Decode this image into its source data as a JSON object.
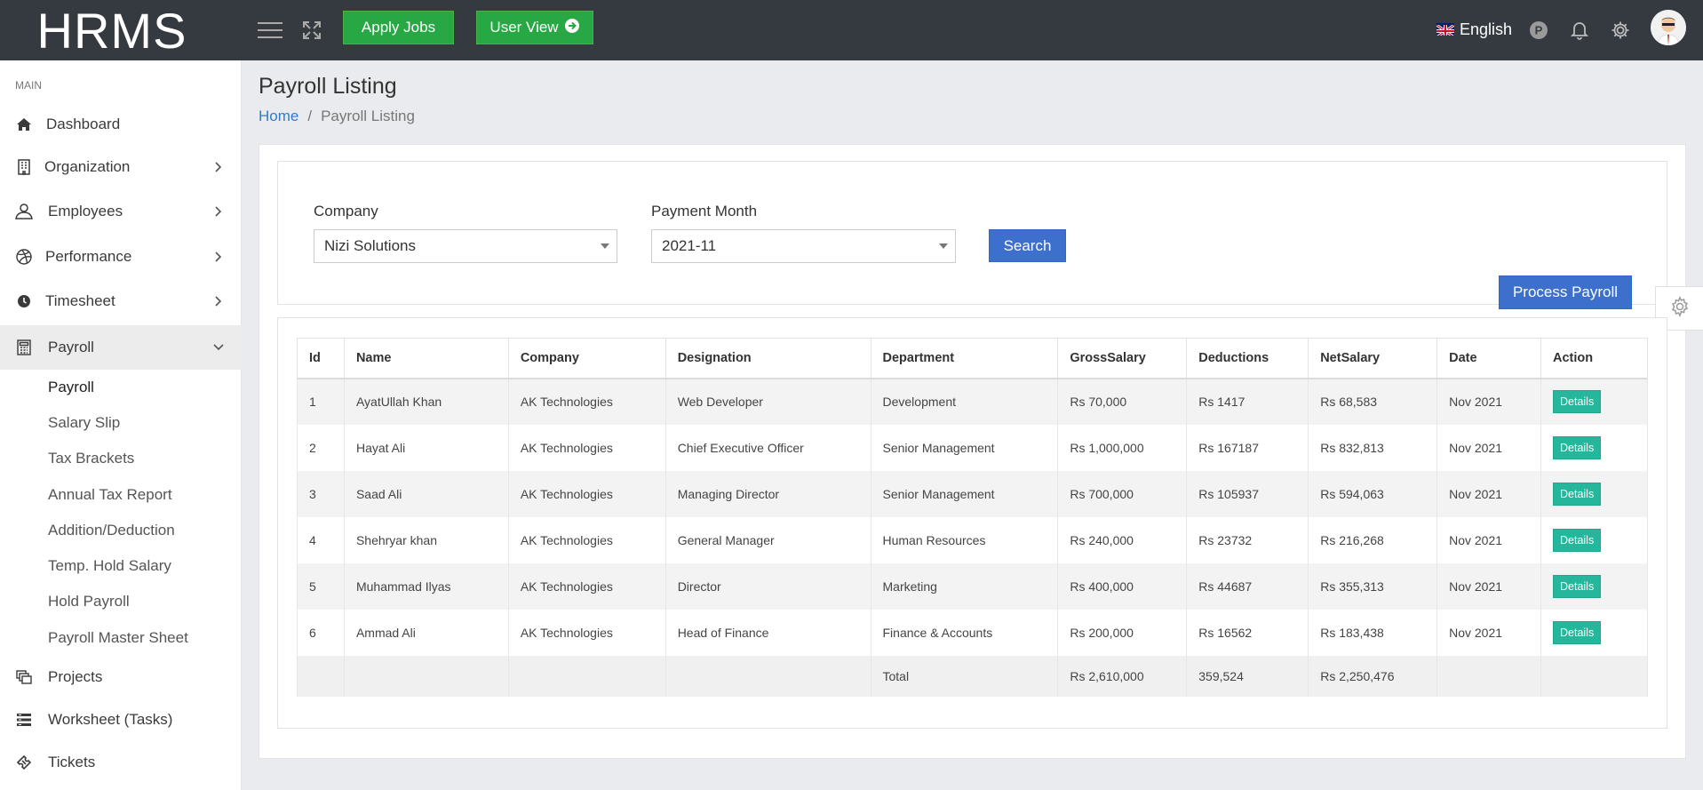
{
  "app": {
    "logo": "HRMS",
    "apply_jobs": "Apply Jobs",
    "user_view": "User View",
    "language": "English"
  },
  "sidebar": {
    "section": "MAIN",
    "items": [
      {
        "label": "Dashboard",
        "icon": "home-icon"
      },
      {
        "label": "Organization",
        "icon": "building-icon"
      },
      {
        "label": "Employees",
        "icon": "user-icon"
      },
      {
        "label": "Performance",
        "icon": "dribbble-icon"
      },
      {
        "label": "Timesheet",
        "icon": "clock-icon"
      },
      {
        "label": "Payroll",
        "icon": "calculator-icon"
      },
      {
        "label": "Projects",
        "icon": "layers-icon"
      },
      {
        "label": "Worksheet (Tasks)",
        "icon": "list-icon"
      },
      {
        "label": "Tickets",
        "icon": "ticket-icon"
      }
    ],
    "payroll_sub": [
      "Payroll",
      "Salary Slip",
      "Tax Brackets",
      "Annual Tax Report",
      "Addition/Deduction",
      "Temp. Hold Salary",
      "Hold Payroll",
      "Payroll Master Sheet"
    ]
  },
  "page": {
    "title": "Payroll Listing",
    "breadcrumb_home": "Home",
    "breadcrumb_sep": "/",
    "breadcrumb_current": "Payroll Listing"
  },
  "filters": {
    "company_label": "Company",
    "company_value": "Nizi Solutions",
    "month_label": "Payment Month",
    "month_value": "2021-11",
    "search": "Search",
    "process": "Process Payroll"
  },
  "table": {
    "headers": [
      "Id",
      "Name",
      "Company",
      "Designation",
      "Department",
      "GrossSalary",
      "Deductions",
      "NetSalary",
      "Date",
      "Action"
    ],
    "rows": [
      [
        "1",
        "AyatUllah Khan",
        "AK Technologies",
        "Web Developer",
        "Development",
        "Rs 70,000",
        "Rs 1417",
        "Rs 68,583",
        "Nov 2021",
        "Details"
      ],
      [
        "2",
        "Hayat Ali",
        "AK Technologies",
        "Chief Executive Officer",
        "Senior Management",
        "Rs 1,000,000",
        "Rs 167187",
        "Rs 832,813",
        "Nov 2021",
        "Details"
      ],
      [
        "3",
        "Saad Ali",
        "AK Technologies",
        "Managing Director",
        "Senior Management",
        "Rs 700,000",
        "Rs 105937",
        "Rs 594,063",
        "Nov 2021",
        "Details"
      ],
      [
        "4",
        "Shehryar khan",
        "AK Technologies",
        "General Manager",
        "Human Resources",
        "Rs 240,000",
        "Rs 23732",
        "Rs 216,268",
        "Nov 2021",
        "Details"
      ],
      [
        "5",
        "Muhammad Ilyas",
        "AK Technologies",
        "Director",
        "Marketing",
        "Rs 400,000",
        "Rs 44687",
        "Rs 355,313",
        "Nov 2021",
        "Details"
      ],
      [
        "6",
        "Ammad Ali",
        "AK Technologies",
        "Head of Finance",
        "Finance & Accounts",
        "Rs 200,000",
        "Rs 16562",
        "Rs 183,438",
        "Nov 2021",
        "Details"
      ]
    ],
    "total": {
      "label": "Total",
      "gross": "Rs 2,610,000",
      "deductions": "359,524",
      "net": "Rs 2,250,476"
    }
  },
  "colors": {
    "topbar": "#343a40",
    "green": "#28a745",
    "blue": "#3d6fcc",
    "teal": "#26b69b"
  }
}
